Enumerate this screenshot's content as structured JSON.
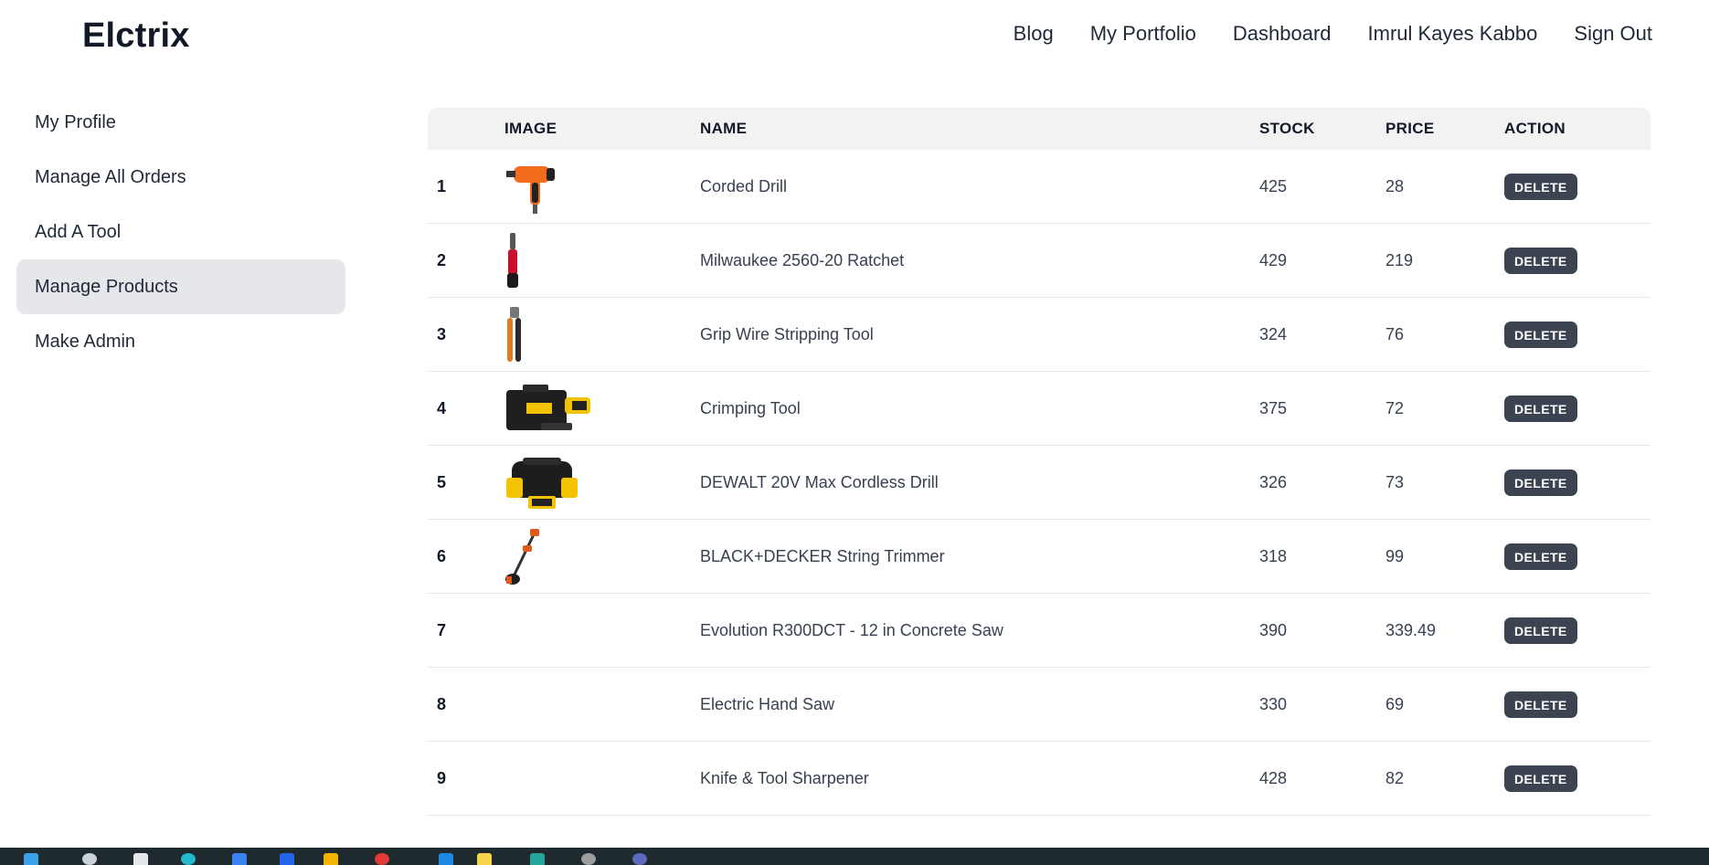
{
  "brand": "Elctrix",
  "nav": [
    "Blog",
    "My Portfolio",
    "Dashboard",
    "Imrul Kayes Kabbo",
    "Sign Out"
  ],
  "sidebar": {
    "items": [
      {
        "label": "My Profile",
        "active": false
      },
      {
        "label": "Manage All Orders",
        "active": false
      },
      {
        "label": "Add A Tool",
        "active": false
      },
      {
        "label": "Manage Products",
        "active": true
      },
      {
        "label": "Make Admin",
        "active": false
      }
    ]
  },
  "table": {
    "headers": {
      "index": "",
      "image": "IMAGE",
      "name": "NAME",
      "stock": "STOCK",
      "price": "PRICE",
      "action": "ACTION"
    },
    "delete_label": "DELETE",
    "rows": [
      {
        "index": "1",
        "image": "corded-drill-image",
        "name": "Corded Drill",
        "stock": "425",
        "price": "28"
      },
      {
        "index": "2",
        "image": "ratchet-image",
        "name": "Milwaukee 2560-20 Ratchet",
        "stock": "429",
        "price": "219"
      },
      {
        "index": "3",
        "image": "wire-stripper-image",
        "name": "Grip Wire Stripping Tool",
        "stock": "324",
        "price": "76"
      },
      {
        "index": "4",
        "image": "crimping-tool-kit-image",
        "name": "Crimping Tool",
        "stock": "375",
        "price": "72"
      },
      {
        "index": "5",
        "image": "cordless-drill-kit-image",
        "name": "DEWALT 20V Max Cordless Drill",
        "stock": "326",
        "price": "73"
      },
      {
        "index": "6",
        "image": "string-trimmer-image",
        "name": "BLACK+DECKER String Trimmer",
        "stock": "318",
        "price": "99"
      },
      {
        "index": "7",
        "image": "",
        "name": "Evolution R300DCT - 12 in Concrete Saw",
        "stock": "390",
        "price": "339.49"
      },
      {
        "index": "8",
        "image": "",
        "name": "Electric Hand Saw",
        "stock": "330",
        "price": "69"
      },
      {
        "index": "9",
        "image": "",
        "name": "Knife & Tool Sharpener",
        "stock": "428",
        "price": "82"
      }
    ]
  },
  "colors": {
    "accent_button": "#3d4451",
    "active_sidebar": "#e5e7eb",
    "table_header": "#f2f2f2",
    "taskbar": "#1f2a2e"
  }
}
